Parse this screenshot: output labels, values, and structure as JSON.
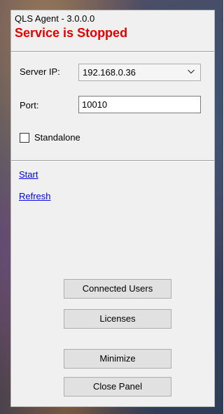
{
  "window": {
    "title": "QLS Agent - 3.0.0.0",
    "status": "Service is Stopped",
    "status_color": "#e60000"
  },
  "server_ip": {
    "label": "Server IP:",
    "value": "192.168.0.36",
    "dropdown_icon": "chevron-down-icon"
  },
  "port": {
    "label": "Port:",
    "value": "10010"
  },
  "standalone": {
    "label": "Standalone",
    "checked": false
  },
  "links": {
    "start": "Start",
    "refresh": "Refresh"
  },
  "buttons": {
    "connected_users": "Connected Users",
    "licenses": "Licenses",
    "minimize": "Minimize",
    "close_panel": "Close Panel"
  }
}
